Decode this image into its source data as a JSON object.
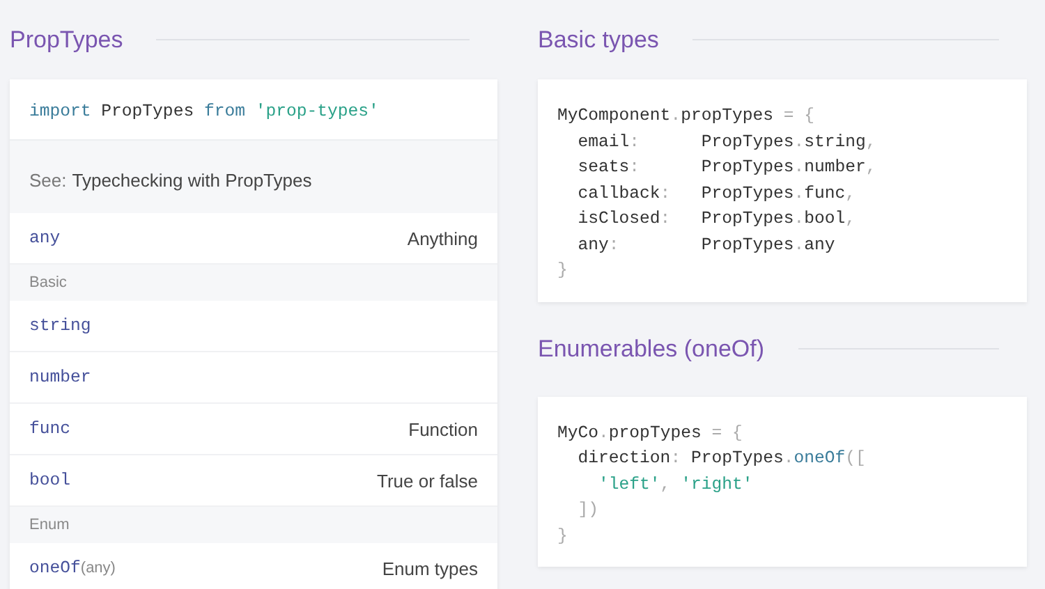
{
  "left": {
    "heading": "PropTypes",
    "import_line": [
      {
        "text": "import",
        "kind": "keyword"
      },
      {
        "text": " PropTypes ",
        "kind": "plain"
      },
      {
        "text": "from",
        "kind": "keyword"
      },
      {
        "text": " 'prop-types'",
        "kind": "string"
      }
    ],
    "note": {
      "label": "See:",
      "link": "Typechecking with PropTypes"
    },
    "rows": [
      {
        "kind": "row",
        "name": "any",
        "desc": "Anything"
      },
      {
        "kind": "section",
        "label": "Basic"
      },
      {
        "kind": "row",
        "name": "string"
      },
      {
        "kind": "row",
        "name": "number"
      },
      {
        "kind": "row",
        "name": "func",
        "desc": "Function"
      },
      {
        "kind": "row",
        "name": "bool",
        "desc": "True or false"
      },
      {
        "kind": "section",
        "label": "Enum"
      },
      {
        "kind": "row",
        "name": "oneOf",
        "arg": "(any)",
        "desc": "Enum types"
      }
    ]
  },
  "right": [
    {
      "heading": "Basic types",
      "code": [
        [
          {
            "text": "MyComponent",
            "kind": "plain"
          },
          {
            "text": ".",
            "kind": "punct"
          },
          {
            "text": "propTypes ",
            "kind": "plain"
          },
          {
            "text": "= {",
            "kind": "punct"
          }
        ],
        [
          {
            "text": "  email",
            "kind": "plain"
          },
          {
            "text": ":      ",
            "kind": "punct"
          },
          {
            "text": "PropTypes",
            "kind": "plain"
          },
          {
            "text": ".",
            "kind": "punct"
          },
          {
            "text": "string",
            "kind": "plain"
          },
          {
            "text": ",",
            "kind": "punct"
          }
        ],
        [
          {
            "text": "  seats",
            "kind": "plain"
          },
          {
            "text": ":      ",
            "kind": "punct"
          },
          {
            "text": "PropTypes",
            "kind": "plain"
          },
          {
            "text": ".",
            "kind": "punct"
          },
          {
            "text": "number",
            "kind": "plain"
          },
          {
            "text": ",",
            "kind": "punct"
          }
        ],
        [
          {
            "text": "  callback",
            "kind": "plain"
          },
          {
            "text": ":   ",
            "kind": "punct"
          },
          {
            "text": "PropTypes",
            "kind": "plain"
          },
          {
            "text": ".",
            "kind": "punct"
          },
          {
            "text": "func",
            "kind": "plain"
          },
          {
            "text": ",",
            "kind": "punct"
          }
        ],
        [
          {
            "text": "  isClosed",
            "kind": "plain"
          },
          {
            "text": ":   ",
            "kind": "punct"
          },
          {
            "text": "PropTypes",
            "kind": "plain"
          },
          {
            "text": ".",
            "kind": "punct"
          },
          {
            "text": "bool",
            "kind": "plain"
          },
          {
            "text": ",",
            "kind": "punct"
          }
        ],
        [
          {
            "text": "  any",
            "kind": "plain"
          },
          {
            "text": ":        ",
            "kind": "punct"
          },
          {
            "text": "PropTypes",
            "kind": "plain"
          },
          {
            "text": ".",
            "kind": "punct"
          },
          {
            "text": "any",
            "kind": "plain"
          }
        ],
        [
          {
            "text": "}",
            "kind": "punct"
          }
        ]
      ]
    },
    {
      "heading": "Enumerables (oneOf)",
      "code": [
        [
          {
            "text": "MyCo",
            "kind": "plain"
          },
          {
            "text": ".",
            "kind": "punct"
          },
          {
            "text": "propTypes ",
            "kind": "plain"
          },
          {
            "text": "= {",
            "kind": "punct"
          }
        ],
        [
          {
            "text": "  direction",
            "kind": "plain"
          },
          {
            "text": ": ",
            "kind": "punct"
          },
          {
            "text": "PropTypes",
            "kind": "plain"
          },
          {
            "text": ".",
            "kind": "punct"
          },
          {
            "text": "oneOf",
            "kind": "keyword"
          },
          {
            "text": "([",
            "kind": "punct"
          }
        ],
        [
          {
            "text": "    'left'",
            "kind": "string"
          },
          {
            "text": ", ",
            "kind": "punct"
          },
          {
            "text": "'right'",
            "kind": "string"
          }
        ],
        [
          {
            "text": "  ])",
            "kind": "punct"
          }
        ],
        [
          {
            "text": "}",
            "kind": "punct"
          }
        ]
      ]
    }
  ]
}
